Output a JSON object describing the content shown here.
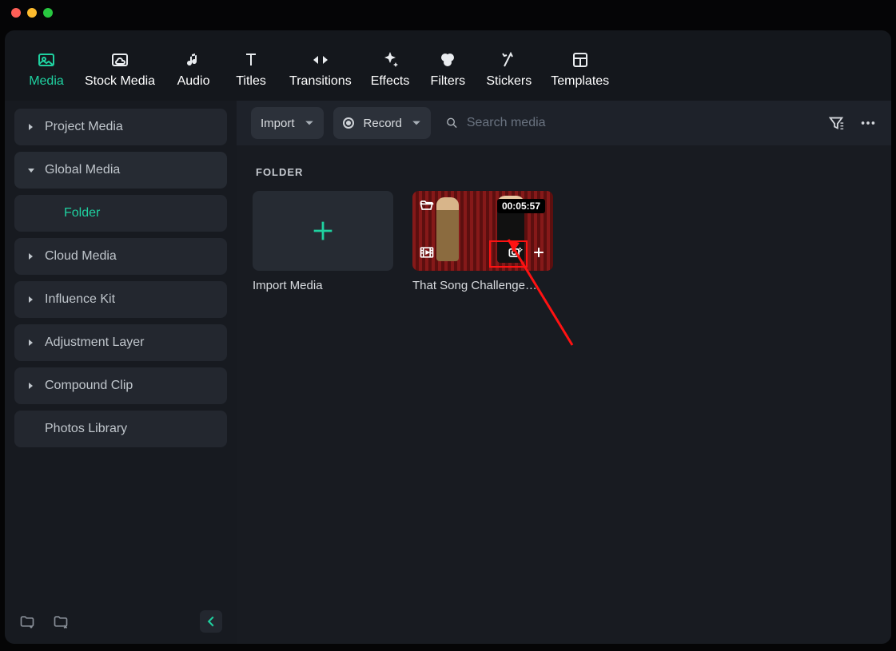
{
  "tabs": [
    "Media",
    "Stock Media",
    "Audio",
    "Titles",
    "Transitions",
    "Effects",
    "Filters",
    "Stickers",
    "Templates"
  ],
  "active_tab": 0,
  "sidebar": {
    "items": [
      {
        "label": "Project Media",
        "expandable": true,
        "expanded": false
      },
      {
        "label": "Global Media",
        "expandable": true,
        "expanded": true,
        "children": [
          {
            "label": "Folder"
          }
        ]
      },
      {
        "label": "Cloud Media",
        "expandable": true,
        "expanded": false
      },
      {
        "label": "Influence Kit",
        "expandable": true,
        "expanded": false
      },
      {
        "label": "Adjustment Layer",
        "expandable": true,
        "expanded": false
      },
      {
        "label": "Compound Clip",
        "expandable": true,
        "expanded": false
      },
      {
        "label": "Photos Library",
        "expandable": false,
        "expanded": false
      }
    ]
  },
  "toolbar": {
    "import_label": "Import",
    "record_label": "Record",
    "search_placeholder": "Search media"
  },
  "section_title": "FOLDER",
  "cards": {
    "import_label": "Import Media",
    "clip": {
      "title": "That Song Challenge…",
      "duration": "00:05:57"
    }
  },
  "colors": {
    "accent": "#1fd1a0"
  }
}
